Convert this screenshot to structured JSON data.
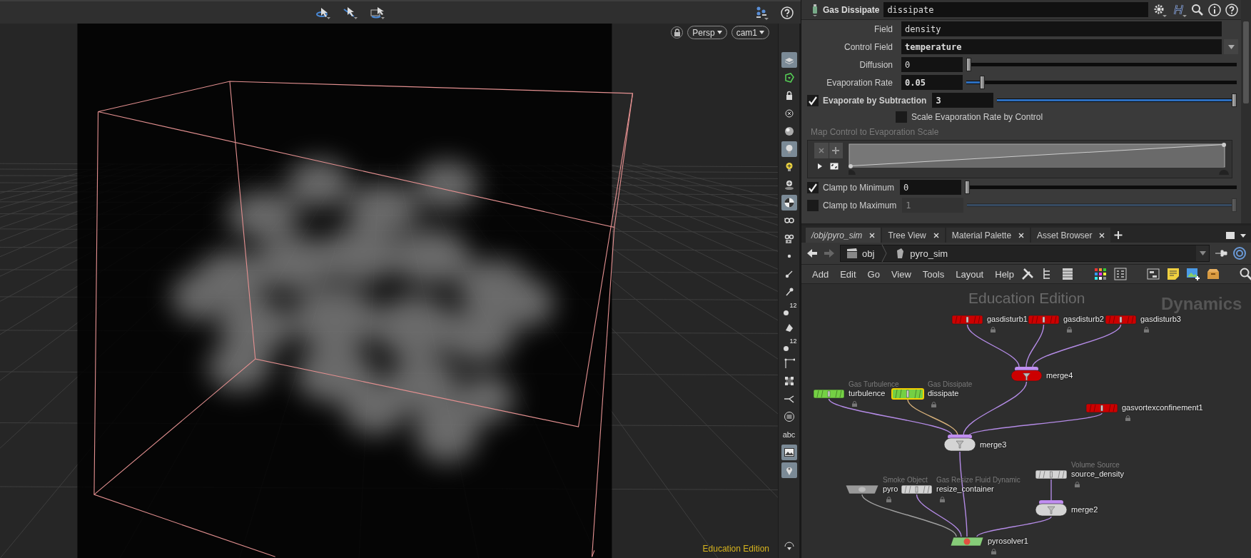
{
  "viewport": {
    "camera_menus": [
      {
        "label": "Persp"
      },
      {
        "label": "cam1"
      }
    ],
    "edition_label": "Education Edition"
  },
  "shelf_tools": [
    {
      "kind": "icon",
      "active": true
    },
    {
      "kind": "icon",
      "active": false
    },
    {
      "kind": "icon",
      "active": false
    },
    {
      "kind": "icon",
      "active": false
    },
    {
      "kind": "icon",
      "active": false
    },
    {
      "kind": "icon",
      "active": true
    },
    {
      "kind": "icon",
      "active": false
    },
    {
      "kind": "icon",
      "active": false
    },
    {
      "kind": "icon",
      "active": true
    },
    {
      "kind": "icon",
      "active": false
    },
    {
      "kind": "icon",
      "active": false
    },
    {
      "kind": "icon",
      "active": false
    },
    {
      "kind": "icon",
      "active": false
    },
    {
      "kind": "icon",
      "active": false
    },
    {
      "kind": "number",
      "badge": "12",
      "active": false
    },
    {
      "kind": "icon",
      "active": false
    },
    {
      "kind": "number",
      "badge": "12",
      "active": false
    },
    {
      "kind": "icon",
      "active": false
    },
    {
      "kind": "icon",
      "active": false
    },
    {
      "kind": "icon",
      "active": false
    },
    {
      "kind": "icon",
      "active": false
    },
    {
      "kind": "text",
      "label": "abc",
      "active": false
    },
    {
      "kind": "icon",
      "active": true
    },
    {
      "kind": "icon",
      "active": true
    },
    {
      "kind": "icon",
      "active": false
    }
  ],
  "parameters": {
    "node_type": "Gas Dissipate",
    "node_name": "dissipate",
    "params": [
      {
        "kind": "string",
        "label": "Field",
        "value": "density",
        "changed": false
      },
      {
        "kind": "menu",
        "label": "Control Field",
        "value": "temperature",
        "changed": true
      },
      {
        "kind": "slider",
        "label": "Diffusion",
        "value": "0",
        "changed": false,
        "level": 0
      },
      {
        "kind": "slider",
        "label": "Evaporation Rate",
        "value": "0.05",
        "changed": true,
        "level": 0.05
      },
      {
        "kind": "toggle_slider",
        "label": "Evaporate by Subtraction",
        "checked": true,
        "value": "3",
        "changed": true,
        "level": 1
      },
      {
        "kind": "checkbox",
        "label": "Scale Evaporation Rate by Control",
        "checked": false
      },
      {
        "kind": "ramp",
        "label": "Map Control to Evaporation Scale"
      },
      {
        "kind": "toggle_slider",
        "label": "Clamp to Minimum",
        "checked": true,
        "value": "0",
        "changed": false,
        "level": 0
      },
      {
        "kind": "toggle_slider",
        "label": "Clamp to Maximum",
        "checked": false,
        "value": "1",
        "changed": false,
        "level": 1
      }
    ]
  },
  "network": {
    "tabs": [
      {
        "label": "/obj/pyro_sim",
        "selected": true
      },
      {
        "label": "Tree View",
        "selected": false
      },
      {
        "label": "Material Palette",
        "selected": false
      },
      {
        "label": "Asset Browser",
        "selected": false
      }
    ],
    "path": [
      {
        "label": "obj"
      },
      {
        "label": "pyro_sim"
      }
    ],
    "menu": [
      "Add",
      "Edit",
      "Go",
      "View",
      "Tools",
      "Layout",
      "Help"
    ],
    "watermark": "Education Edition",
    "context_label": "Dynamics",
    "nodes": [
      {
        "name": "gasdisturb1",
        "kind": "rect",
        "color": "#cc0000",
        "selected": false
      },
      {
        "name": "gasdisturb2",
        "kind": "rect",
        "color": "#cc0000",
        "selected": false
      },
      {
        "name": "gasdisturb3",
        "kind": "rect",
        "color": "#cc0000",
        "selected": false
      },
      {
        "name": "merge4",
        "kind": "merge",
        "color": "#cc0000",
        "selected": false
      },
      {
        "name": "turbulence",
        "type_label": "Gas Turbulence",
        "kind": "rect",
        "color": "#74d044",
        "selected": false
      },
      {
        "name": "dissipate",
        "type_label": "Gas Dissipate",
        "kind": "rect",
        "color": "#74d044",
        "selected": true
      },
      {
        "name": "gasvortexconfinement1",
        "kind": "rect",
        "color": "#cc0000",
        "selected": false
      },
      {
        "name": "merge3",
        "kind": "merge",
        "color": "#d4d4d4",
        "selected": false
      },
      {
        "name": "source_density",
        "type_label": "Volume Source",
        "kind": "rect",
        "color": "#d4d4d4",
        "selected": false
      },
      {
        "name": "pyro",
        "type_label": "Smoke Object",
        "kind": "trapezoid",
        "color": "#9a9a9a",
        "selected": false
      },
      {
        "name": "resize_container",
        "type_label": "Gas Resize Fluid Dynamic",
        "kind": "rect",
        "color": "#d4d4d4",
        "selected": false
      },
      {
        "name": "merge2",
        "kind": "merge",
        "color": "#d4d4d4",
        "selected": false
      },
      {
        "name": "pyrosolver1",
        "kind": "parallelogram",
        "color": "#86cc78",
        "selected": false
      }
    ]
  }
}
